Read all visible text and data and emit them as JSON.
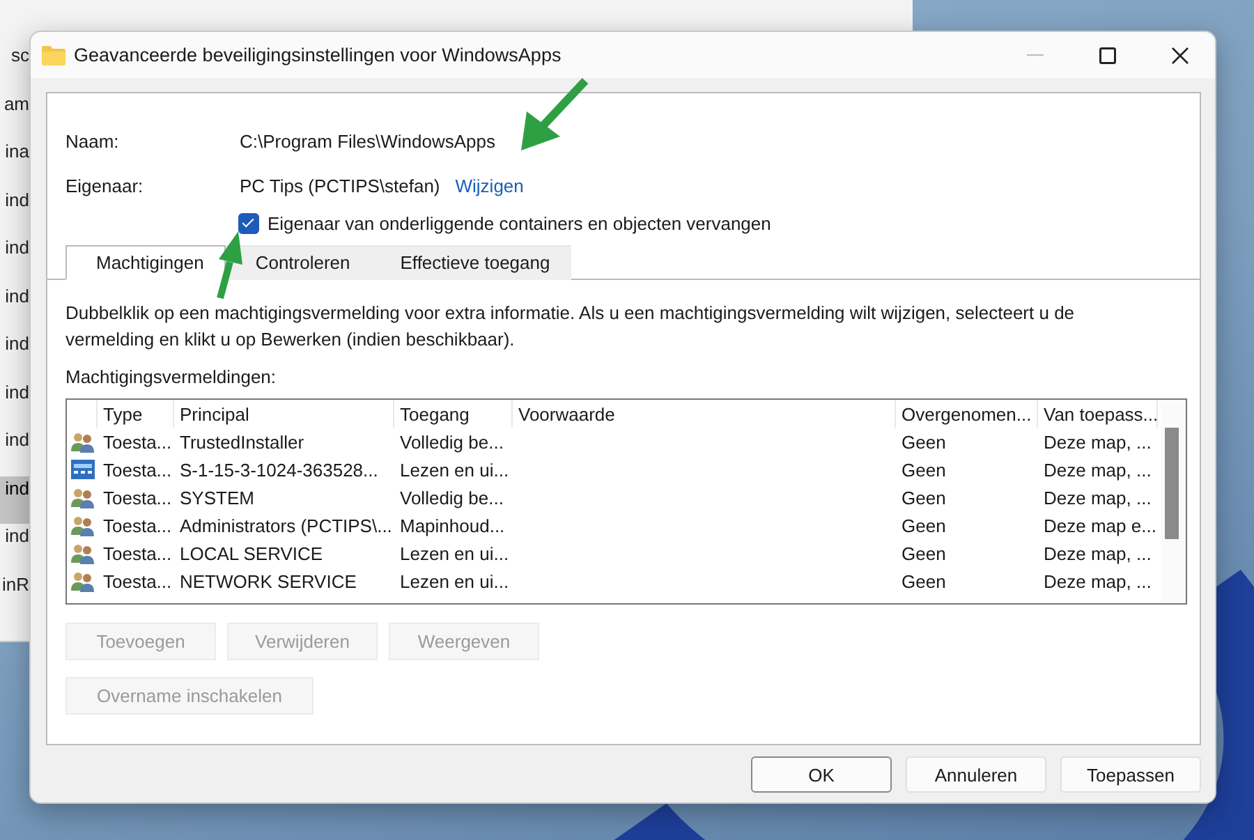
{
  "background_window": {
    "items": [
      {
        "text": "sc",
        "selected": false
      },
      {
        "text": "am",
        "selected": false
      },
      {
        "text": "ina",
        "selected": false
      },
      {
        "text": "ind",
        "selected": false
      },
      {
        "text": "ind",
        "selected": false
      },
      {
        "text": "ind",
        "selected": false
      },
      {
        "text": "ind",
        "selected": false
      },
      {
        "text": "ind",
        "selected": false
      },
      {
        "text": "ind",
        "selected": false
      },
      {
        "text": "ind",
        "selected": true
      },
      {
        "text": "ind",
        "selected": false
      },
      {
        "text": "inR",
        "selected": false
      }
    ]
  },
  "window": {
    "title": "Geavanceerde beveiligingsinstellingen voor WindowsApps"
  },
  "fields": [
    {
      "label": "Naam:",
      "value": "C:\\Program Files\\WindowsApps"
    },
    {
      "label": "Eigenaar:",
      "value": "PC Tips (PCTIPS\\stefan)",
      "link": "Wijzigen"
    }
  ],
  "checkbox": {
    "label": "Eigenaar van onderliggende containers en objecten vervangen",
    "checked": true
  },
  "tabs": [
    {
      "label": "Machtigingen",
      "selected": true
    },
    {
      "label": "Controleren",
      "selected": false
    },
    {
      "label": "Effectieve toegang",
      "selected": false
    }
  ],
  "description": "Dubbelklik op een machtigingsvermelding voor extra informatie. Als u een machtigingsvermelding wilt wijzigen, selecteert u de vermelding en klikt u op Bewerken (indien beschikbaar).",
  "list_label": "Machtigingsvermeldingen:",
  "table": {
    "columns": [
      "Type",
      "Principal",
      "Toegang",
      "Voorwaarde",
      "Overgenomen...",
      "Van toepass..."
    ],
    "rows": [
      {
        "kind": "users",
        "cells": [
          "Toesta...",
          "TrustedInstaller",
          "Volledig be...",
          "",
          "Geen",
          "Deze map, ..."
        ]
      },
      {
        "kind": "package",
        "cells": [
          "Toesta...",
          "S-1-15-3-1024-363528...",
          "Lezen en ui...",
          "",
          "Geen",
          "Deze map, ..."
        ]
      },
      {
        "kind": "users",
        "cells": [
          "Toesta...",
          "SYSTEM",
          "Volledig be...",
          "",
          "Geen",
          "Deze map, ..."
        ]
      },
      {
        "kind": "users",
        "cells": [
          "Toesta...",
          "Administrators (PCTIPS\\...",
          "Mapinhoud...",
          "",
          "Geen",
          "Deze map e..."
        ]
      },
      {
        "kind": "users",
        "cells": [
          "Toesta...",
          "LOCAL SERVICE",
          "Lezen en ui...",
          "",
          "Geen",
          "Deze map, ..."
        ]
      },
      {
        "kind": "users",
        "cells": [
          "Toesta...",
          "NETWORK SERVICE",
          "Lezen en ui...",
          "",
          "Geen",
          "Deze map, ..."
        ]
      }
    ]
  },
  "action_buttons": [
    {
      "label": "Toevoegen",
      "disabled": true
    },
    {
      "label": "Verwijderen",
      "disabled": true
    },
    {
      "label": "Weergeven",
      "disabled": true
    }
  ],
  "inheritance_button": {
    "label": "Overname inschakelen",
    "disabled": true
  },
  "footer_buttons": [
    {
      "label": "OK",
      "default": true
    },
    {
      "label": "Annuleren",
      "default": false
    },
    {
      "label": "Toepassen",
      "default": false
    }
  ]
}
